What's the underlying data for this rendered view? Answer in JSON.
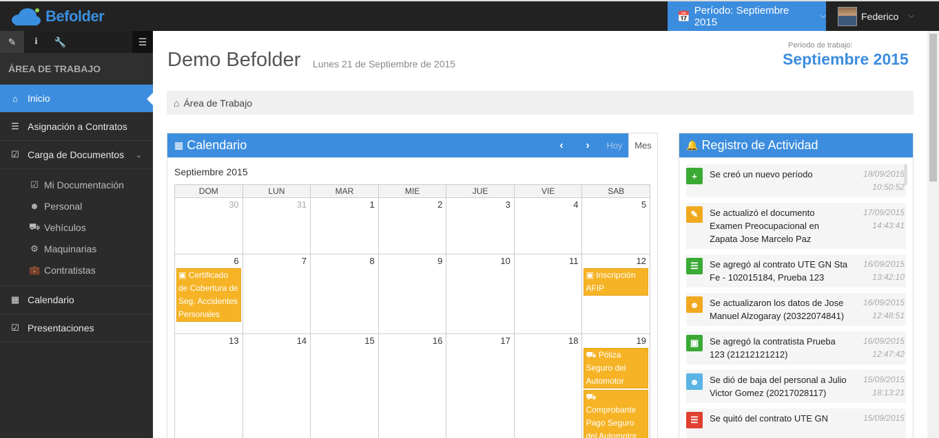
{
  "app": {
    "name": "Befolder"
  },
  "colors": {
    "accent": "#3c8dde",
    "event": "#f5b325",
    "green": "#3aaa35",
    "orange": "#f0a91e",
    "lightblue": "#5bb4e5",
    "red": "#e0402f"
  },
  "topbar": {
    "period_button": "Período: Septiembre 2015",
    "user_name": "Federico"
  },
  "sidebar": {
    "heading": "ÁREA DE TRABAJO",
    "items": [
      {
        "label": "Inicio",
        "icon": "home-icon"
      },
      {
        "label": "Asignación a Contratos",
        "icon": "list-icon"
      },
      {
        "label": "Carga de Documentos",
        "icon": "check-square-icon"
      }
    ],
    "subitems": [
      {
        "label": "Mi Documentación",
        "icon": "check-square-icon"
      },
      {
        "label": "Personal",
        "icon": "users-icon"
      },
      {
        "label": "Vehículos",
        "icon": "truck-icon"
      },
      {
        "label": "Maquinarias",
        "icon": "gears-icon"
      },
      {
        "label": "Contratistas",
        "icon": "briefcase-icon"
      }
    ],
    "bottom_items": [
      {
        "label": "Calendario",
        "icon": "calendar-icon"
      },
      {
        "label": "Presentaciones",
        "icon": "calendar-check-icon"
      }
    ]
  },
  "main": {
    "title": "Demo Befolder",
    "date": "Lunes 21 de Septiembre de 2015",
    "period_label": "Período de trabajo:",
    "period_value": "Septiembre 2015",
    "breadcrumb": "Área de Trabajo"
  },
  "calendar": {
    "title": "Calendario",
    "today_label": "Hoy",
    "month_button": "Mes",
    "month_label": "Septiembre 2015",
    "weekdays": [
      "DOM",
      "LUN",
      "MAR",
      "MIE",
      "JUE",
      "VIE",
      "SAB"
    ],
    "weeks": [
      {
        "days": [
          {
            "n": "30",
            "other": true,
            "events": []
          },
          {
            "n": "31",
            "other": true,
            "events": []
          },
          {
            "n": "1",
            "events": []
          },
          {
            "n": "2",
            "events": []
          },
          {
            "n": "3",
            "events": []
          },
          {
            "n": "4",
            "events": []
          },
          {
            "n": "5",
            "events": []
          }
        ]
      },
      {
        "days": [
          {
            "n": "6",
            "events": [
              "Certificado de Cobertura de Seg. Accidentes Personales"
            ]
          },
          {
            "n": "7",
            "events": []
          },
          {
            "n": "8",
            "events": []
          },
          {
            "n": "9",
            "events": []
          },
          {
            "n": "10",
            "events": []
          },
          {
            "n": "11",
            "events": []
          },
          {
            "n": "12",
            "events": [
              "Inscripción AFIP"
            ]
          }
        ]
      },
      {
        "days": [
          {
            "n": "13",
            "events": []
          },
          {
            "n": "14",
            "events": []
          },
          {
            "n": "15",
            "events": []
          },
          {
            "n": "16",
            "events": []
          },
          {
            "n": "17",
            "events": []
          },
          {
            "n": "18",
            "events": []
          },
          {
            "n": "19",
            "events": [
              "Póliza Seguro del Automotor",
              "Comprobante Pago Seguro del Automotor"
            ]
          }
        ]
      }
    ]
  },
  "activity": {
    "title": "Registro de Actividad",
    "items": [
      {
        "text": "Se creó un nuevo período",
        "date": "18/09/2015",
        "time": "10:50:52",
        "icon": "plus-icon",
        "color": "#3aaa35"
      },
      {
        "text": "Se actualizó el documento Examen Preocupacional en Zapata Jose Marcelo Paz",
        "date": "17/09/2015",
        "time": "14:43:41",
        "icon": "edit-icon",
        "color": "#f0a91e"
      },
      {
        "text": "Se agregó al contrato UTE GN Sta Fe - 102015184, Prueba 123",
        "date": "16/09/2015",
        "time": "13:42:10",
        "icon": "list-icon",
        "color": "#3aaa35"
      },
      {
        "text": "Se actualizaron los datos de Jose Manuel Alzogaray (20322074841)",
        "date": "16/09/2015",
        "time": "12:48:51",
        "icon": "users-icon",
        "color": "#f0a91e"
      },
      {
        "text": "Se agregó la contratista Prueba 123 (21212121212)",
        "date": "16/09/2015",
        "time": "12:47:42",
        "icon": "briefcase-icon",
        "color": "#3aaa35"
      },
      {
        "text": "Se dió de baja del personal a Julio Victor Gomez (20217028117)",
        "date": "15/09/2015",
        "time": "18:13:21",
        "icon": "users-icon",
        "color": "#5bb4e5"
      },
      {
        "text": "Se quitó del contrato UTE GN",
        "date": "15/09/2015",
        "time": "",
        "icon": "list-icon",
        "color": "#e0402f"
      }
    ]
  }
}
